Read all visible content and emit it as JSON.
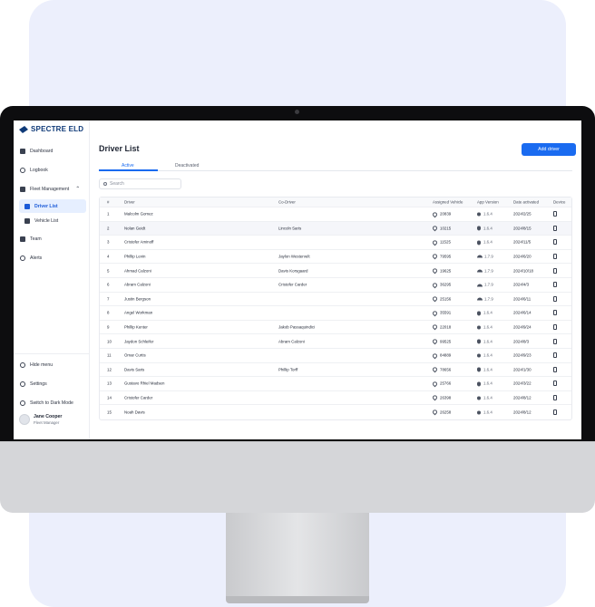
{
  "brand": {
    "name": "SPECTRE ELD"
  },
  "sidebar": {
    "items": [
      {
        "label": "Dashboard",
        "icon": "dashboard-icon"
      },
      {
        "label": "Logbook",
        "icon": "logbook-icon"
      },
      {
        "label": "Fleet Management",
        "icon": "fleet-icon"
      },
      {
        "label": "Driver List",
        "icon": "driver-list-icon"
      },
      {
        "label": "Vehicle List",
        "icon": "vehicle-list-icon"
      },
      {
        "label": "Team",
        "icon": "team-icon"
      },
      {
        "label": "Alerts",
        "icon": "alerts-icon"
      }
    ],
    "bottom": {
      "hide_menu": "Hide menu",
      "settings": "Settings",
      "dark_mode": "Switch to Dark Mode"
    },
    "user": {
      "name": "Jane Cooper",
      "role": "Fleet Manager"
    }
  },
  "header": {
    "title": "Driver List",
    "add_button": "Add driver"
  },
  "tabs": [
    {
      "label": "Active"
    },
    {
      "label": "Deactivated"
    }
  ],
  "search": {
    "placeholder": "Search"
  },
  "table": {
    "columns": [
      "#",
      "Driver",
      "Co-Driver",
      "Assigned Vehicle",
      "App Version",
      "Date activated",
      "Device"
    ],
    "rows": [
      {
        "num": "1",
        "driver": "Malcolm Gomez",
        "codriver": "",
        "vehicle": "20839",
        "os": "apple",
        "version": "1.6.4",
        "date": "2024/2/25"
      },
      {
        "num": "2",
        "driver": "Nolan Geidt",
        "codriver": "Lincoln Saris",
        "vehicle": "10215",
        "os": "apple",
        "version": "1.6.4",
        "date": "2024/8/15"
      },
      {
        "num": "3",
        "driver": "Cristofer Aminoff",
        "codriver": "",
        "vehicle": "11525",
        "os": "apple",
        "version": "1.6.4",
        "date": "2024/11/5"
      },
      {
        "num": "4",
        "driver": "Phillip Levin",
        "codriver": "Jaylon Westervelt",
        "vehicle": "79595",
        "os": "android",
        "version": "1.7.9",
        "date": "2024/6/20"
      },
      {
        "num": "5",
        "driver": "Ahmad Calzoni",
        "codriver": "Davis Korsgaard",
        "vehicle": "19625",
        "os": "android",
        "version": "1.7.9",
        "date": "2024/10/18"
      },
      {
        "num": "6",
        "driver": "Abram Calzoni",
        "codriver": "Cristofer Carder",
        "vehicle": "36295",
        "os": "android",
        "version": "1.7.9",
        "date": "2024/4/3"
      },
      {
        "num": "7",
        "driver": "Justin Bergson",
        "codriver": "",
        "vehicle": "25156",
        "os": "android",
        "version": "1.7.9",
        "date": "2024/6/11"
      },
      {
        "num": "8",
        "driver": "Angel Workman",
        "codriver": "",
        "vehicle": "35591",
        "os": "apple",
        "version": "1.6.4",
        "date": "2024/6/14"
      },
      {
        "num": "9",
        "driver": "Phillip Kenter",
        "codriver": "Jakob Passaquindici",
        "vehicle": "22018",
        "os": "apple",
        "version": "1.6.4",
        "date": "2024/9/24"
      },
      {
        "num": "10",
        "driver": "Jaydon Schleifer",
        "codriver": "Abram Calzoni",
        "vehicle": "99525",
        "os": "apple",
        "version": "1.6.4",
        "date": "2024/8/3"
      },
      {
        "num": "11",
        "driver": "Omar Curtis",
        "codriver": "",
        "vehicle": "84889",
        "os": "apple",
        "version": "1.6.4",
        "date": "2024/9/23"
      },
      {
        "num": "12",
        "driver": "Davis Saris",
        "codriver": "Phillip Torff",
        "vehicle": "78656",
        "os": "apple",
        "version": "1.6.4",
        "date": "2024/1/30"
      },
      {
        "num": "13",
        "driver": "Gustavo Rhiel Madsen",
        "codriver": "",
        "vehicle": "25766",
        "os": "apple",
        "version": "1.6.4",
        "date": "2024/3/22"
      },
      {
        "num": "14",
        "driver": "Cristofer Carder",
        "codriver": "",
        "vehicle": "26398",
        "os": "apple",
        "version": "1.6.4",
        "date": "2024/8/12"
      },
      {
        "num": "15",
        "driver": "Noah Davis",
        "codriver": "",
        "vehicle": "26258",
        "os": "apple",
        "version": "1.6.4",
        "date": "2024/8/12"
      }
    ]
  },
  "colors": {
    "accent": "#1a6bf0",
    "brand": "#0f3a78",
    "active_nav_bg": "#e6efff"
  }
}
